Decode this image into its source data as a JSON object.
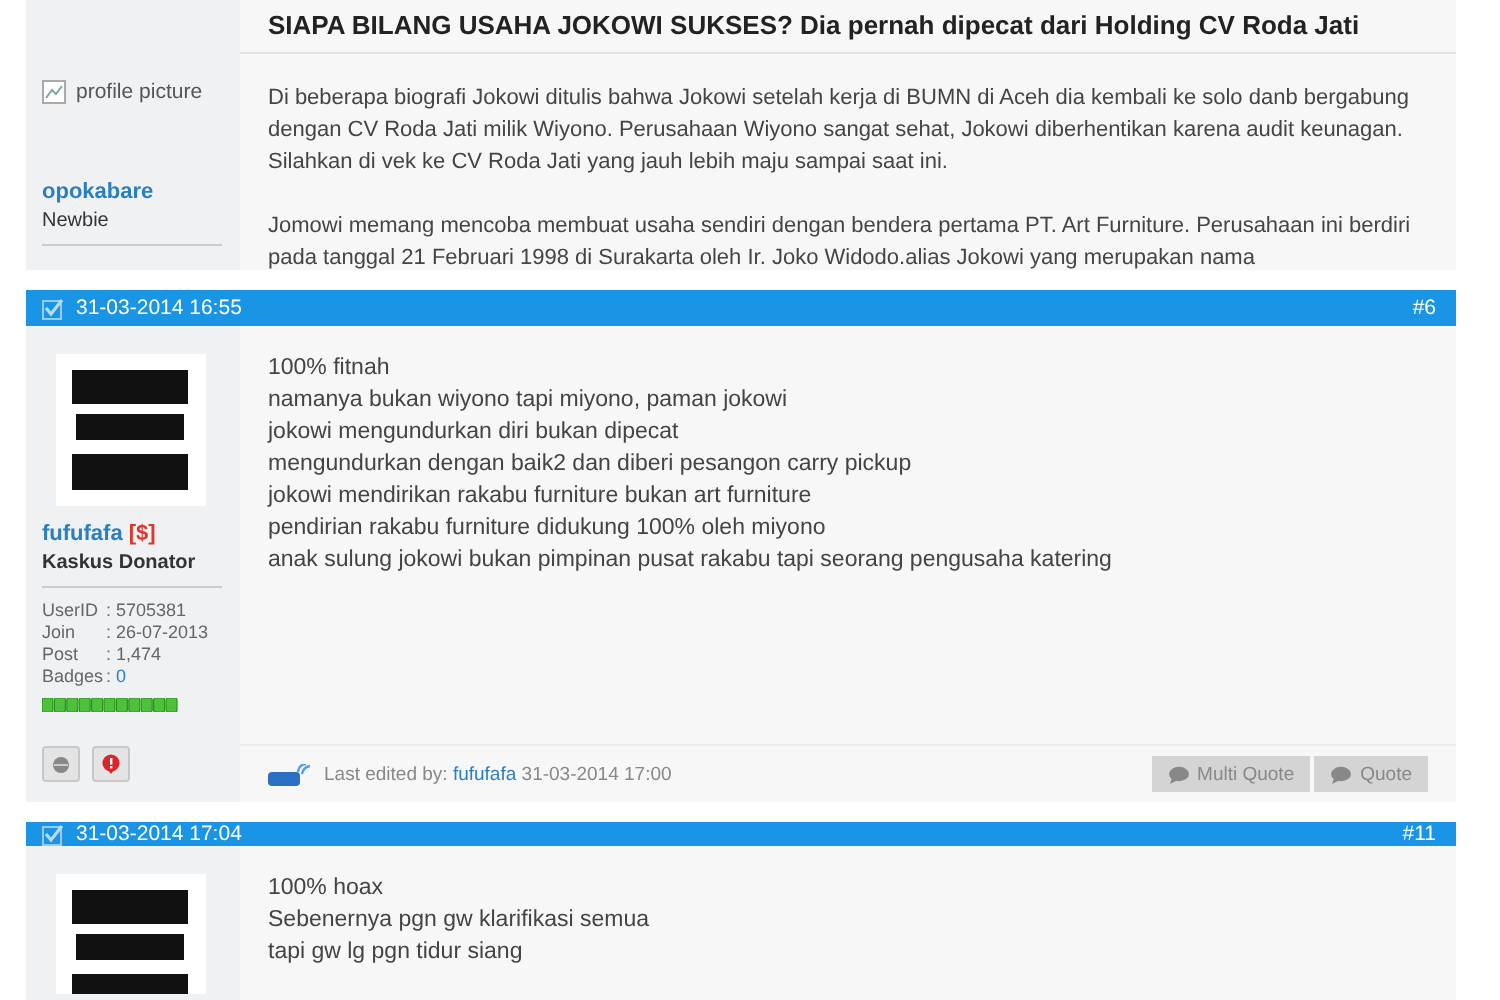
{
  "posts": [
    {
      "kind": "cut",
      "title": "SIAPA BILANG USAHA JOKOWI SUKSES? Dia pernah dipecat dari Holding CV Roda Jati",
      "user": {
        "avatar_alt": "profile picture",
        "name": "opokabare",
        "rank": "Newbie"
      },
      "paragraphs": [
        "Di beberapa biografi Jokowi ditulis bahwa Jokowi setelah kerja di BUMN di Aceh dia kembali ke solo danb bergabung dengan CV Roda Jati milik Wiyono. Perusahaan Wiyono sangat sehat, Jokowi diberhentikan karena audit keunagan. Silahkan di vek ke CV Roda Jati yang jauh lebih maju sampai saat ini.",
        "Jomowi memang mencoba membuat usaha sendiri dengan bendera pertama PT. Art Furniture. Perusahaan ini berdiri pada tanggal 21 Februari 1998 di Surakarta oleh Ir. Joko Widodo.alias Jokowi yang merupakan nama"
      ]
    },
    {
      "kind": "full",
      "date": "31-03-2014 16:55",
      "number": "#6",
      "user": {
        "name": "fufufafa",
        "badge": "[$]",
        "rank": "Kaskus Donator",
        "stats": [
          {
            "label": "UserID",
            "value": ": 5705381"
          },
          {
            "label": "Join",
            "value": ": 26-07-2013"
          },
          {
            "label": "Post",
            "value": ": 1,474"
          },
          {
            "label": "Badges",
            "value": ": ",
            "link": "0"
          }
        ]
      },
      "lines": [
        "100% fitnah",
        "namanya bukan wiyono tapi miyono, paman jokowi",
        "jokowi mengundurkan diri bukan dipecat",
        "mengundurkan dengan baik2 dan diberi pesangon carry pickup",
        "jokowi mendirikan rakabu furniture bukan art furniture",
        "pendirian rakabu furniture didukung 100% oleh miyono",
        "anak sulung jokowi bukan pimpinan pusat rakabu tapi seorang pengusaha katering"
      ],
      "footer": {
        "edited_label": "Last edited by:",
        "editor": "fufufafa",
        "edited_at": "31-03-2014 17:00"
      },
      "buttons": [
        "Multi Quote",
        "Quote"
      ]
    },
    {
      "kind": "cut_bottom",
      "date": "31-03-2014 17:04",
      "number": "#11",
      "lines": [
        "100% hoax",
        "Sebenernya pgn gw klarifikasi semua",
        "tapi gw lg pgn tidur siang"
      ]
    }
  ]
}
